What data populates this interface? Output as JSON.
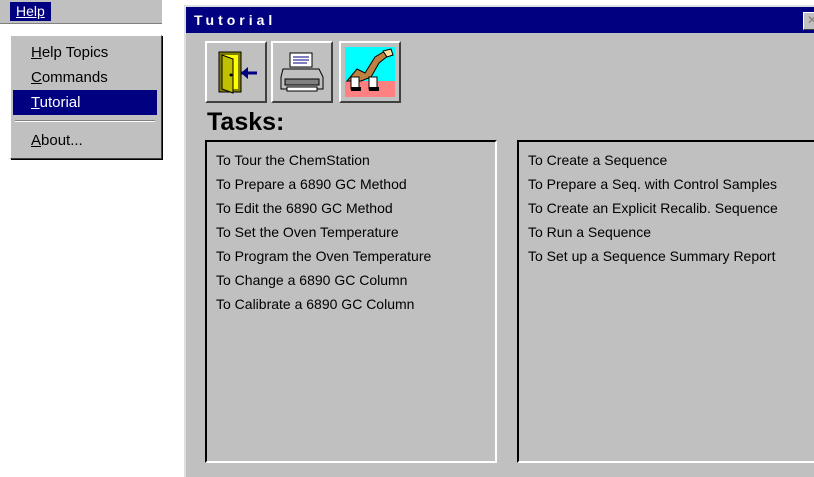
{
  "menubar": {
    "help_label": "Help"
  },
  "help_menu": {
    "items": [
      {
        "label": "Help Topics",
        "accel": "H",
        "rest": "elp Topics",
        "selected": false
      },
      {
        "label": "Commands",
        "accel": "C",
        "rest": "ommands",
        "selected": false
      },
      {
        "label": "Tutorial",
        "accel": "T",
        "rest": "utorial",
        "selected": true
      },
      {
        "label": "About...",
        "accel": "A",
        "rest": "bout...",
        "selected": false
      }
    ]
  },
  "tutorial_window": {
    "title": "Tutorial",
    "close_glyph": "✕",
    "toolbar": [
      {
        "icon": "exit-door-icon"
      },
      {
        "icon": "printer-icon"
      },
      {
        "icon": "tour-guide-icon"
      }
    ],
    "tasks_heading": "Tasks:",
    "left_tasks": [
      "To Tour the ChemStation",
      "To Prepare a 6890 GC Method",
      "To Edit the 6890 GC Method",
      "To Set the Oven Temperature",
      "To Program the Oven Temperature",
      "To Change a 6890 GC Column",
      "To Calibrate a 6890 GC Column"
    ],
    "right_tasks": [
      "To Create a Sequence",
      "To Prepare a Seq. with Control Samples",
      "To Create an Explicit Recalib. Sequence",
      "To Run a Sequence",
      "To Set up a Sequence Summary Report"
    ]
  },
  "colors": {
    "title_bar": "#000080",
    "selection": "#000080",
    "face": "#c0c0c0"
  }
}
